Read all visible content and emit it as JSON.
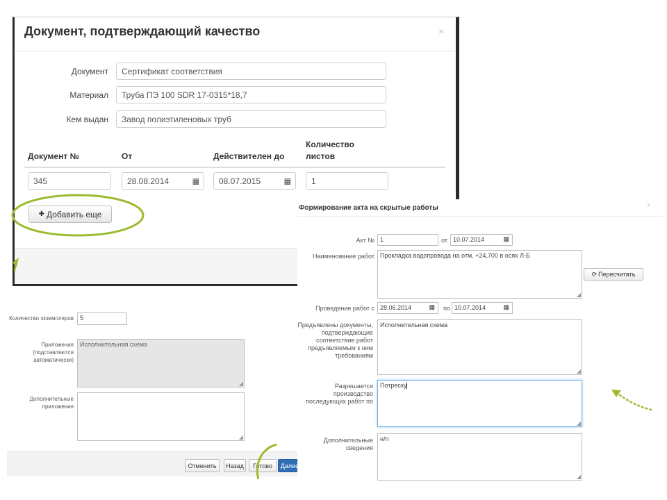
{
  "modal_quality": {
    "title": "Документ, подтверждающий качество",
    "close_glyph": "×",
    "fields": {
      "document_label": "Документ",
      "document_value": "Сертификат соответствия",
      "material_label": "Материал",
      "material_value": "Труба ПЭ 100 SDR 17-0315*18,7",
      "issued_by_label": "Кем выдан",
      "issued_by_value": "Завод полиэтиленовых труб"
    },
    "table": {
      "col_number": "Документ №",
      "col_from": "От",
      "col_valid_until": "Действителен до",
      "col_sheets_line1": "Количество",
      "col_sheets_line2": "листов",
      "row": {
        "number": "345",
        "from": "28.08.2014",
        "valid_until": "08.07.2015",
        "sheets": "1"
      }
    },
    "add_more_button": "Добавить еще",
    "add_more_icon": "✚",
    "calendar_glyph": "▦"
  },
  "modal_act": {
    "title": "Формирование акта на скрытые работы",
    "close_glyph": "×",
    "act_no_label": "Акт №",
    "act_no_value": "1",
    "act_from_label": "от",
    "act_date": "10.07.2014",
    "work_name_label": "Наименование работ",
    "work_name_value": "Прокладка водопровода на отм. +24,700 в осях Л-Б",
    "recalc_button": "Пересчитать",
    "recalc_icon": "⟳",
    "period_label": "Проведение работ с",
    "period_from": "28.06.2014",
    "period_to_label": "по",
    "period_to": "10.07.2014",
    "docs_label": "Предъявлены документы, подтверждающие соответствие работ предъявляемым к ним требованиям",
    "docs_value": "Исполнительная схема",
    "permit_label": "Разрешается производство последующих работ по",
    "permit_value": "Потреску",
    "extra_label": "Дополнительные сведения",
    "extra_value": "н/п",
    "calendar_glyph": "▦"
  },
  "bottom_form": {
    "copies_label": "Количество экземпляров",
    "copies_value": "5",
    "attachments_label": "Приложения (подставляются автоматически)",
    "attachments_value": "Исполнительная схема",
    "extra_attachments_label": "Дополнительные приложения",
    "extra_attachments_value": "",
    "buttons": {
      "cancel": "Отменить",
      "back": "Назад",
      "ready": "Готово",
      "next": "Далее"
    }
  },
  "colors": {
    "annotation_green": "#9bbb2e",
    "primary_blue": "#2f6db5",
    "focus_blue": "#66afe9"
  }
}
